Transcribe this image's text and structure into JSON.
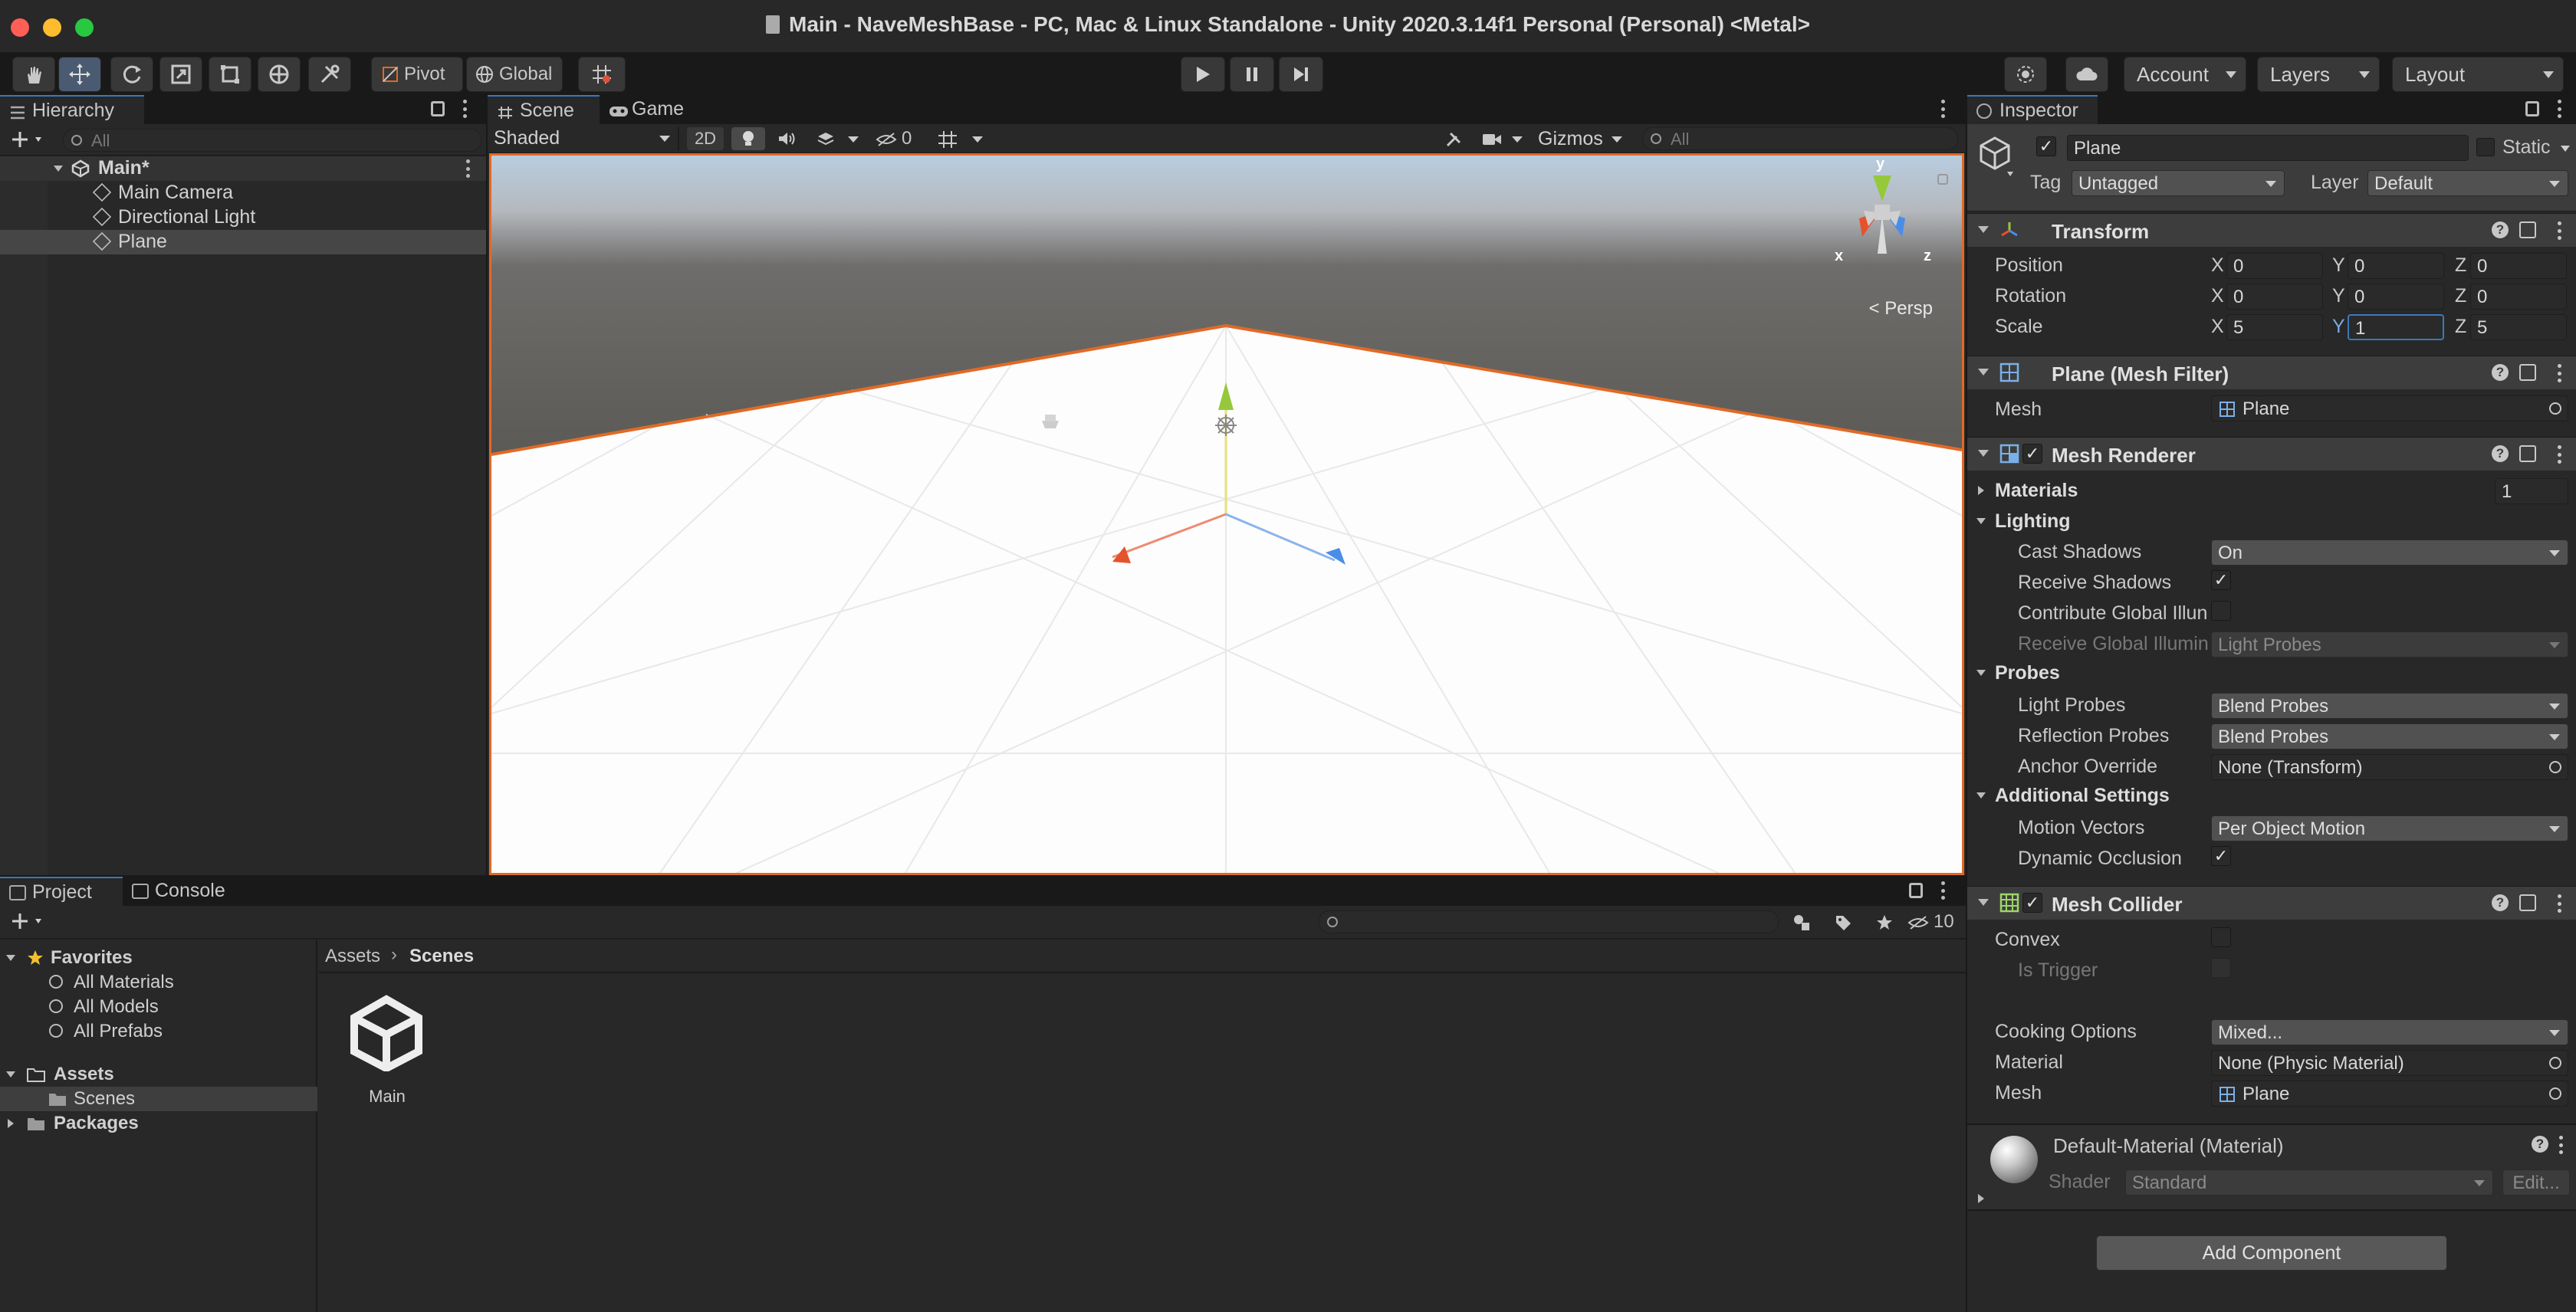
{
  "window": {
    "title": "Main - NaveMeshBase - PC, Mac & Linux Standalone - Unity 2020.3.14f1 Personal (Personal) <Metal>",
    "traffic_colors": {
      "close": "#ff5f57",
      "minimize": "#febc2e",
      "zoom": "#28c840"
    }
  },
  "toolbar": {
    "pivot_label": "Pivot",
    "global_label": "Global",
    "account_label": "Account",
    "layers_label": "Layers",
    "layout_label": "Layout"
  },
  "hierarchy": {
    "tab_label": "Hierarchy",
    "search_placeholder": "All",
    "scene_name": "Main*",
    "items": [
      {
        "label": "Main Camera"
      },
      {
        "label": "Directional Light"
      },
      {
        "label": "Plane"
      }
    ]
  },
  "scene": {
    "tabs": [
      {
        "label": "Scene"
      },
      {
        "label": "Game"
      }
    ],
    "shading_mode": "Shaded",
    "mode_2d": "2D",
    "hidden_count": "0",
    "gizmos_label": "Gizmos",
    "search_placeholder": "All",
    "persp_label": "< Persp",
    "axis_labels": {
      "x": "x",
      "y": "y",
      "z": "z"
    },
    "colors": {
      "selection_outline": "#e06a26",
      "axis_x": "#e4532e",
      "axis_y": "#96c83c",
      "axis_z": "#4a8de8"
    }
  },
  "project": {
    "tabs": [
      {
        "label": "Project"
      },
      {
        "label": "Console"
      }
    ],
    "hidden_count": "10",
    "favorites_label": "Favorites",
    "favorites": [
      {
        "label": "All Materials"
      },
      {
        "label": "All Models"
      },
      {
        "label": "All Prefabs"
      }
    ],
    "assets_label": "Assets",
    "scenes_label": "Scenes",
    "packages_label": "Packages",
    "breadcrumb_root": "Assets",
    "breadcrumb_current": "Scenes",
    "asset_name": "Main"
  },
  "inspector": {
    "tab_label": "Inspector",
    "object_name": "Plane",
    "static_label": "Static",
    "tag_label": "Tag",
    "tag_value": "Untagged",
    "layer_label": "Layer",
    "layer_value": "Default",
    "transform": {
      "title": "Transform",
      "position_label": "Position",
      "rotation_label": "Rotation",
      "scale_label": "Scale",
      "position": {
        "x": "0",
        "y": "0",
        "z": "0"
      },
      "rotation": {
        "x": "0",
        "y": "0",
        "z": "0"
      },
      "scale": {
        "x": "5",
        "y": "1",
        "z": "5"
      },
      "axis_x": "X",
      "axis_y": "Y",
      "axis_z": "Z"
    },
    "mesh_filter": {
      "title": "Plane (Mesh Filter)",
      "mesh_label": "Mesh",
      "mesh_value": "Plane"
    },
    "mesh_renderer": {
      "title": "Mesh Renderer",
      "materials_label": "Materials",
      "materials_count": "1",
      "lighting_label": "Lighting",
      "cast_shadows_label": "Cast Shadows",
      "cast_shadows_value": "On",
      "receive_shadows_label": "Receive Shadows",
      "contribute_gi_label": "Contribute Global Illun",
      "receive_gi_label": "Receive Global Illumin",
      "receive_gi_value": "Light Probes",
      "probes_label": "Probes",
      "light_probes_label": "Light Probes",
      "light_probes_value": "Blend Probes",
      "reflection_probes_label": "Reflection Probes",
      "reflection_probes_value": "Blend Probes",
      "anchor_override_label": "Anchor Override",
      "anchor_override_value": "None (Transform)",
      "additional_settings_label": "Additional Settings",
      "motion_vectors_label": "Motion Vectors",
      "motion_vectors_value": "Per Object Motion",
      "dynamic_occlusion_label": "Dynamic Occlusion"
    },
    "mesh_collider": {
      "title": "Mesh Collider",
      "convex_label": "Convex",
      "is_trigger_label": "Is Trigger",
      "cooking_options_label": "Cooking Options",
      "cooking_options_value": "Mixed...",
      "material_label": "Material",
      "material_value": "None (Physic Material)",
      "mesh_label": "Mesh",
      "mesh_value": "Plane"
    },
    "material": {
      "name": "Default-Material (Material)",
      "shader_label": "Shader",
      "shader_value": "Standard",
      "edit_label": "Edit..."
    },
    "add_component_label": "Add Component",
    "check_glyph": "✓"
  }
}
